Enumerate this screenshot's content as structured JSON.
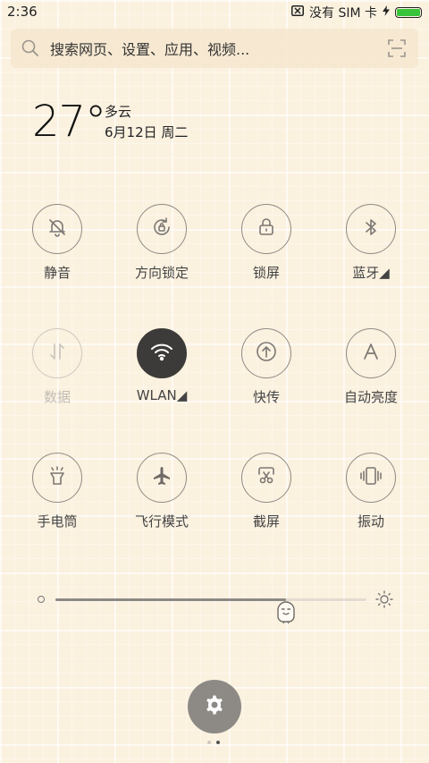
{
  "status_bar": {
    "time": "2:36",
    "sim": "没有 SIM 卡",
    "battery_level": 1.0,
    "battery_color": "#38c43a"
  },
  "search": {
    "placeholder": "搜索网页、设置、应用、视频..."
  },
  "weather": {
    "temperature": "27°",
    "condition": "多云",
    "date": "6月12日 周二"
  },
  "tiles": [
    {
      "label": "静音",
      "icon": "bell-off-icon",
      "state": "off"
    },
    {
      "label": "方向锁定",
      "icon": "rotation-lock-icon",
      "state": "off"
    },
    {
      "label": "锁屏",
      "icon": "lock-icon",
      "state": "off"
    },
    {
      "label": "蓝牙◢",
      "icon": "bluetooth-icon",
      "state": "off"
    },
    {
      "label": "数据",
      "icon": "mobile-data-icon",
      "state": "disabled"
    },
    {
      "label": "WLAN◢",
      "icon": "wifi-icon",
      "state": "on"
    },
    {
      "label": "快传",
      "icon": "quick-transfer-icon",
      "state": "off"
    },
    {
      "label": "自动亮度",
      "icon": "auto-brightness-icon",
      "state": "off"
    },
    {
      "label": "手电筒",
      "icon": "flashlight-icon",
      "state": "off"
    },
    {
      "label": "飞行模式",
      "icon": "airplane-icon",
      "state": "off"
    },
    {
      "label": "截屏",
      "icon": "screenshot-icon",
      "state": "off"
    },
    {
      "label": "振动",
      "icon": "vibrate-icon",
      "state": "off"
    }
  ],
  "brightness": {
    "level": 0.74
  },
  "pager": {
    "pages": 2,
    "current": 2
  },
  "colors": {
    "active_tile": "#3d3b39",
    "background": "#fbf1df"
  }
}
